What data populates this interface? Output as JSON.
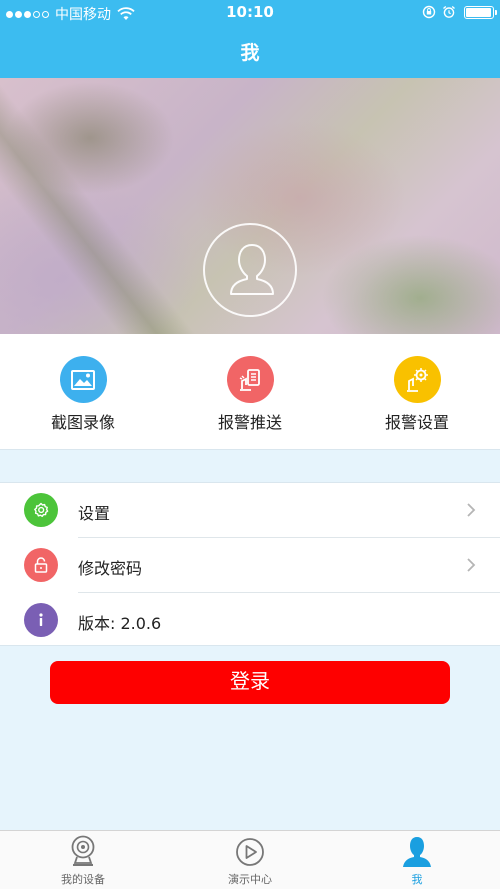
{
  "status_bar": {
    "carrier": "中国移动",
    "time": "10:10",
    "signal_filled": 3,
    "signal_total": 5,
    "battery_level": 0.9
  },
  "header": {
    "title": "我"
  },
  "quick_actions": [
    {
      "label": "截图录像",
      "icon": "image-icon",
      "color": "#3db0ee"
    },
    {
      "label": "报警推送",
      "icon": "alarm-push-icon",
      "color": "#f16566"
    },
    {
      "label": "报警设置",
      "icon": "alarm-settings-icon",
      "color": "#f9c100"
    }
  ],
  "menu": {
    "items": [
      {
        "label": "设置",
        "icon": "gear-icon",
        "color": "#4cc43a"
      },
      {
        "label": "修改密码",
        "icon": "lock-icon",
        "color": "#f16566"
      },
      {
        "label": "版本: 2.0.6",
        "icon": "info-icon",
        "color": "#7a5fb4"
      }
    ]
  },
  "login_button": {
    "label": "登录",
    "color": "#fe0000"
  },
  "tab_bar": {
    "tabs": [
      {
        "label": "我的设备",
        "icon": "camera-icon"
      },
      {
        "label": "演示中心",
        "icon": "play-icon"
      },
      {
        "label": "我",
        "icon": "person-icon",
        "active": true
      }
    ],
    "active_color": "#1a9fe0"
  },
  "theme": {
    "header_color": "#3cbcf0",
    "background": "#e6f4fc"
  }
}
